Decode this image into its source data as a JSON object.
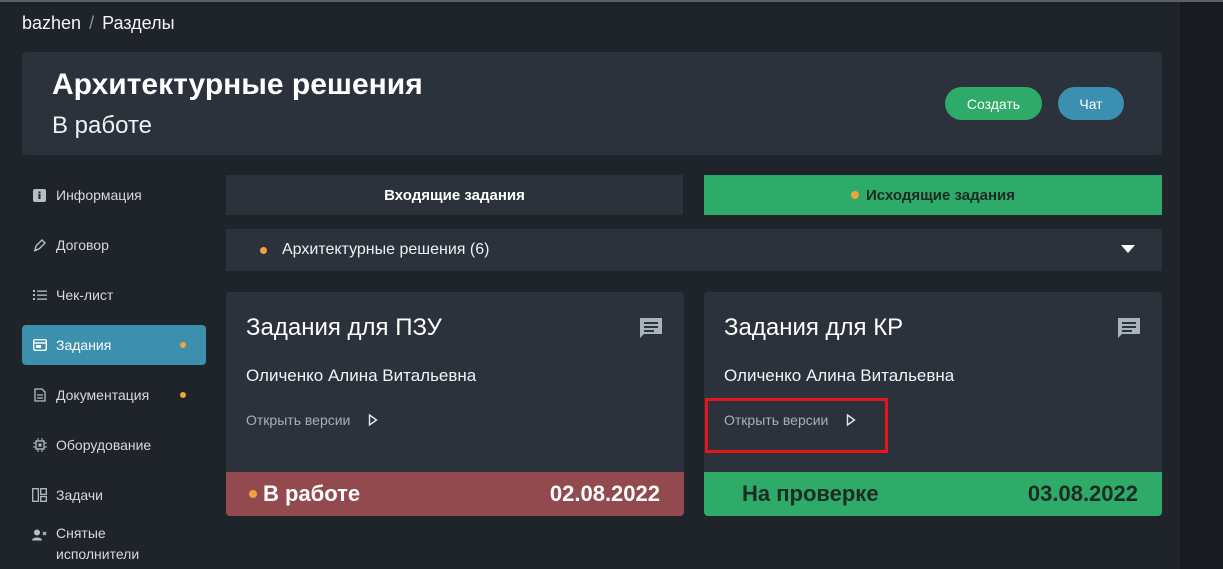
{
  "breadcrumb": {
    "root": "bazhen",
    "separator": "/",
    "current": "Разделы"
  },
  "header": {
    "title": "Архитектурные решения",
    "subtitle": "В работе",
    "create_label": "Создать",
    "chat_label": "Чат"
  },
  "sidebar": {
    "items": [
      {
        "label": "Информация",
        "icon": "info-icon"
      },
      {
        "label": "Договор",
        "icon": "pen-icon"
      },
      {
        "label": "Чек-лист",
        "icon": "checklist-icon"
      },
      {
        "label": "Задания",
        "icon": "window-icon",
        "active": true,
        "dot": true
      },
      {
        "label": "Документация",
        "icon": "document-icon",
        "dot": true
      },
      {
        "label": "Оборудование",
        "icon": "chip-icon"
      },
      {
        "label": "Задачи",
        "icon": "board-icon"
      },
      {
        "label": "Снятые исполнители",
        "icon": "user-remove-icon"
      }
    ]
  },
  "tabs": {
    "incoming": "Входящие задания",
    "outgoing": "Исходящие задания"
  },
  "section": {
    "label": "Архитектурные решения (6)"
  },
  "cards": [
    {
      "title": "Задания для ПЗУ",
      "person": "Оличенко Алина Витальевна",
      "open_label": "Открыть версии",
      "status": "В работе",
      "date": "02.08.2022"
    },
    {
      "title": "Задания для КР",
      "person": "Оличенко Алина Витальевна",
      "open_label": "Открыть версии",
      "status": "На проверке",
      "date": "03.08.2022"
    }
  ],
  "colors": {
    "accent_green": "#2eab69",
    "accent_blue": "#3d8fae",
    "status_red": "#934a4e",
    "dot_orange": "#f0a23c",
    "highlight_red": "#e8141c"
  }
}
